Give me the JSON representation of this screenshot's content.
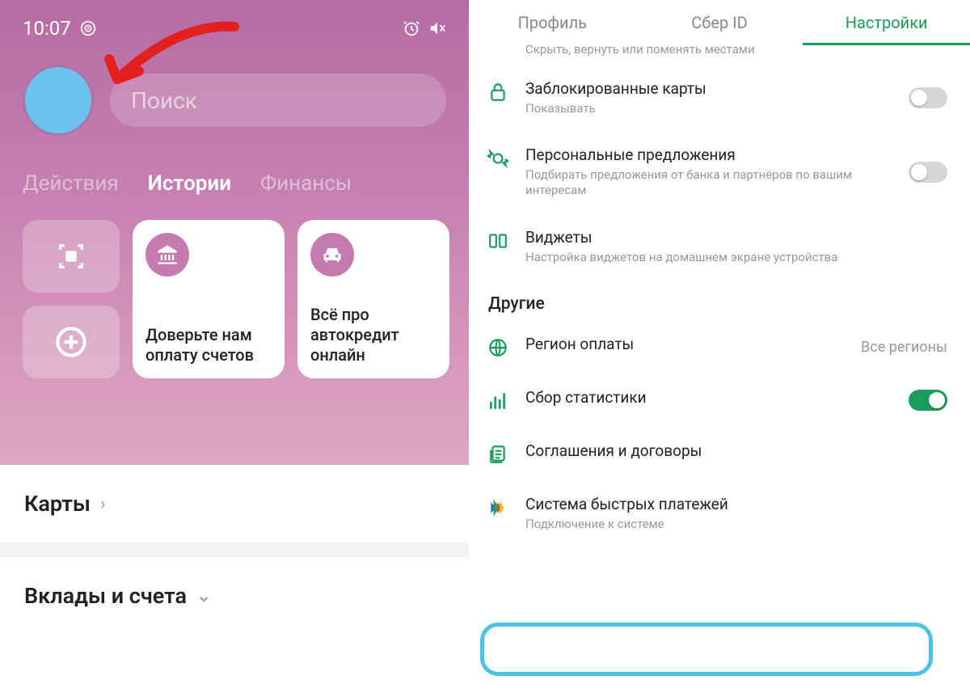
{
  "left": {
    "status_time": "10:07",
    "search_placeholder": "Поиск",
    "tabs": {
      "actions": "Действия",
      "stories": "Истории",
      "finance": "Финансы"
    },
    "story1": "Доверьте нам оплату счетов",
    "story2": "Всё про автокредит онлайн",
    "section_cards": "Карты",
    "section_deposits": "Вклады и счета"
  },
  "right": {
    "tabs": {
      "profile": "Профиль",
      "sberid": "Сбер ID",
      "settings": "Настройки"
    },
    "hide_sub": "Скрыть, вернуть или поменять местами",
    "blocked_title": "Заблокированные карты",
    "blocked_sub": "Показывать",
    "personal_title": "Персональные предложения",
    "personal_sub": "Подбирать предложения от банка и партнёров по вашим интересам",
    "widgets_title": "Виджеты",
    "widgets_sub": "Настройка виджетов на домашнем экране устройства",
    "section_other": "Другие",
    "region_title": "Регион оплаты",
    "region_value": "Все регионы",
    "stats_title": "Сбор статистики",
    "agreements_title": "Соглашения и договоры",
    "sbp_title": "Система быстрых платежей",
    "sbp_sub": "Подключение к системе"
  }
}
